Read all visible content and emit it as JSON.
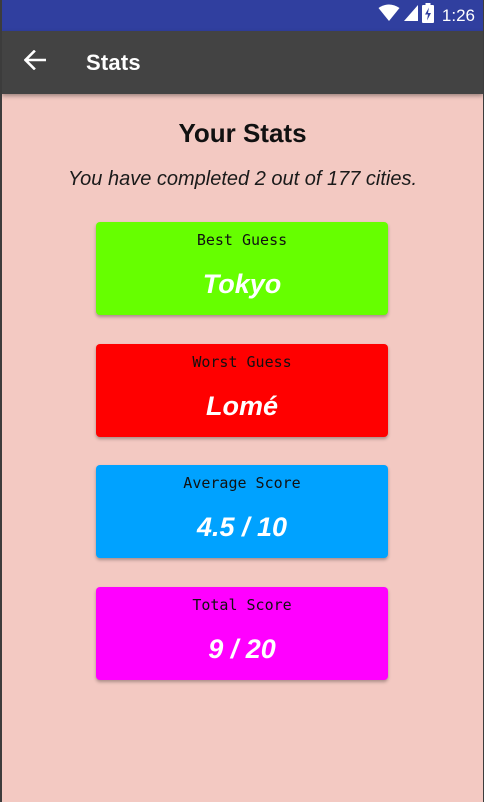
{
  "status_bar": {
    "time": "1:26",
    "icons": [
      "wifi-icon",
      "signal-icon",
      "battery-icon"
    ]
  },
  "app_bar": {
    "back_icon": "arrow-left-icon",
    "title": "Stats"
  },
  "page": {
    "title": "Your Stats",
    "progress": "You have completed 2 out of 177 cities."
  },
  "cards": [
    {
      "label": "Best Guess",
      "value": "Tokyo",
      "color": "#66ff00"
    },
    {
      "label": "Worst Guess",
      "value": "Lomé",
      "color": "#ff0000"
    },
    {
      "label": "Average Score",
      "value": "4.5 / 10",
      "color": "#00a2ff"
    },
    {
      "label": "Total Score",
      "value": "9 / 20",
      "color": "#ff00ff"
    }
  ],
  "colors": {
    "status_bar": "#303f9f",
    "app_bar": "#434343",
    "background": "#f3c9c2"
  }
}
